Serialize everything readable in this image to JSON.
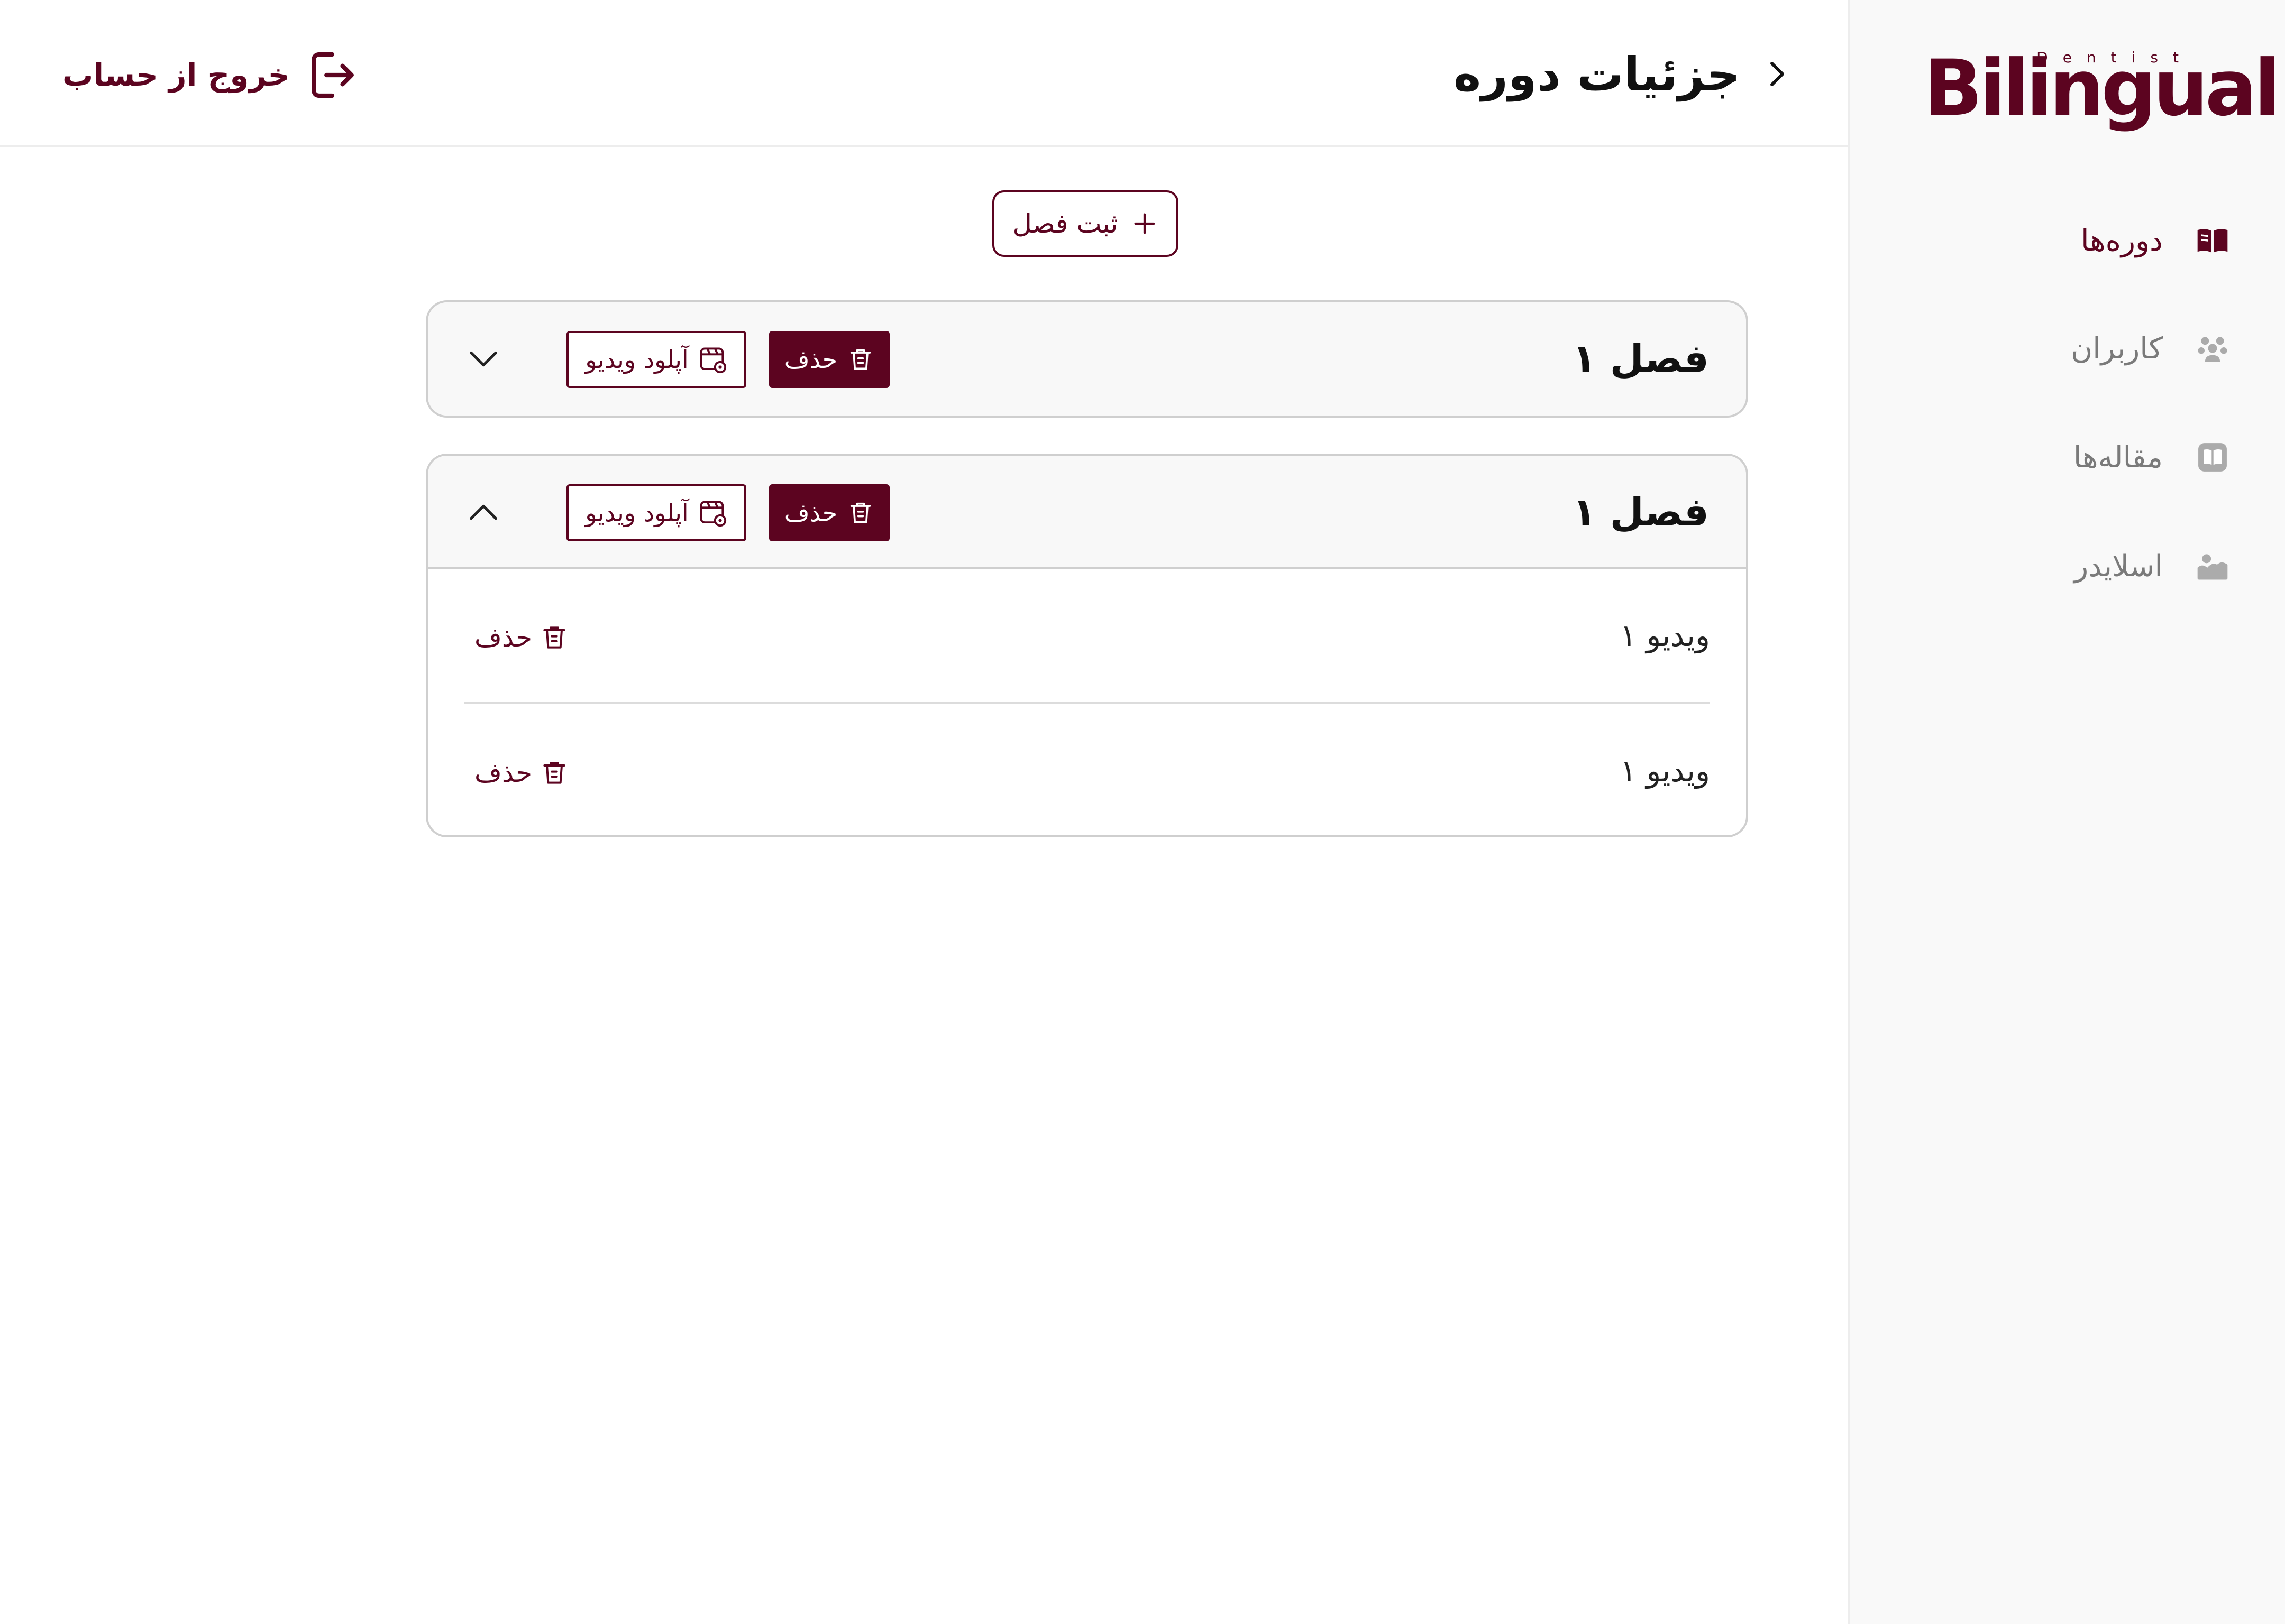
{
  "brand": {
    "name": "Bilingual",
    "tagline": "Dentist",
    "color": "#5c0420"
  },
  "sidebar": {
    "items": [
      {
        "label": "دوره‌ها",
        "icon": "book-open-icon",
        "active": true
      },
      {
        "label": "کاربران",
        "icon": "users-icon",
        "active": false
      },
      {
        "label": "مقاله‌ها",
        "icon": "article-icon",
        "active": false
      },
      {
        "label": "اسلایدر",
        "icon": "image-icon",
        "active": false
      }
    ]
  },
  "header": {
    "title": "جزئیات دوره",
    "logout_label": "خروج از حساب"
  },
  "main": {
    "add_chapter_label": "ثبت فصل",
    "chapters": [
      {
        "title": "فصل ۱",
        "delete_label": "حذف",
        "upload_label": "آپلود ویدیو",
        "expanded": false,
        "videos": []
      },
      {
        "title": "فصل ۱",
        "delete_label": "حذف",
        "upload_label": "آپلود ویدیو",
        "expanded": true,
        "videos": [
          {
            "title": "ویدیو ۱",
            "delete_label": "حذف"
          },
          {
            "title": "ویدیو ۱",
            "delete_label": "حذف"
          }
        ]
      }
    ]
  },
  "colors": {
    "accent": "#5c0420",
    "sidebar_bg": "#f9f9f9",
    "muted_text": "#7a7a7a",
    "border": "#cfcfcf"
  }
}
